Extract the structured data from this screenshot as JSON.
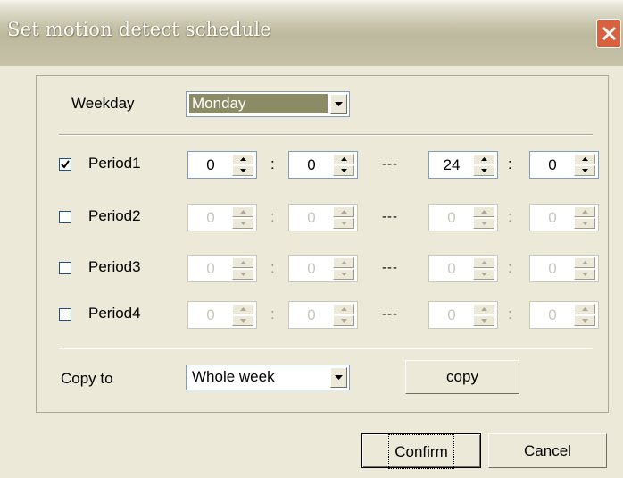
{
  "window": {
    "title": "Set motion detect schedule"
  },
  "weekday": {
    "label": "Weekday",
    "selected": "Monday"
  },
  "periods": [
    {
      "label": "Period1",
      "checked": true,
      "start_hour": "0",
      "start_min": "0",
      "end_hour": "24",
      "end_min": "0"
    },
    {
      "label": "Period2",
      "checked": false,
      "start_hour": "0",
      "start_min": "0",
      "end_hour": "0",
      "end_min": "0"
    },
    {
      "label": "Period3",
      "checked": false,
      "start_hour": "0",
      "start_min": "0",
      "end_hour": "0",
      "end_min": "0"
    },
    {
      "label": "Period4",
      "checked": false,
      "start_hour": "0",
      "start_min": "0",
      "end_hour": "0",
      "end_min": "0"
    }
  ],
  "separators": {
    "colon": ":",
    "dash": "---"
  },
  "copy": {
    "label": "Copy to",
    "selected": "Whole week",
    "button": "copy"
  },
  "buttons": {
    "confirm": "Confirm",
    "cancel": "Cancel"
  },
  "colors": {
    "title_text": "#ffffff",
    "close_button": "#d8613f",
    "selection": "#8b8c66",
    "dialog_bg": "#ece9d8"
  },
  "icons": {
    "close": "close-icon",
    "dropdown": "chevron-down-icon",
    "spin_up": "arrow-up-icon",
    "spin_down": "arrow-down-icon",
    "check": "check-icon"
  }
}
